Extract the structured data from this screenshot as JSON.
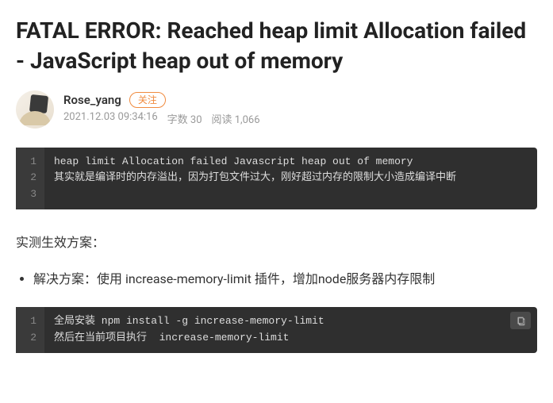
{
  "title": "FATAL ERROR: Reached heap limit Allocation failed - JavaScript heap out of memory",
  "author": {
    "name": "Rose_yang",
    "follow_label": "关注"
  },
  "meta": {
    "datetime": "2021.12.03 09:34:16",
    "wordcount_label": "字数 30",
    "views_label": "阅读 1,066"
  },
  "code1": {
    "lines": [
      "heap limit Allocation failed Javascript heap out of memory",
      "其实就是编译时的内存溢出，因为打包文件过大，刚好超过内存的限制大小造成编译中断",
      ""
    ]
  },
  "body": {
    "para1": "实测生效方案：",
    "bullet1": "解决方案：使用 increase-memory-limit 插件，增加node服务器内存限制"
  },
  "code2": {
    "lines": [
      "全局安装 npm install -g increase-memory-limit",
      "然后在当前项目执行  increase-memory-limit"
    ]
  }
}
